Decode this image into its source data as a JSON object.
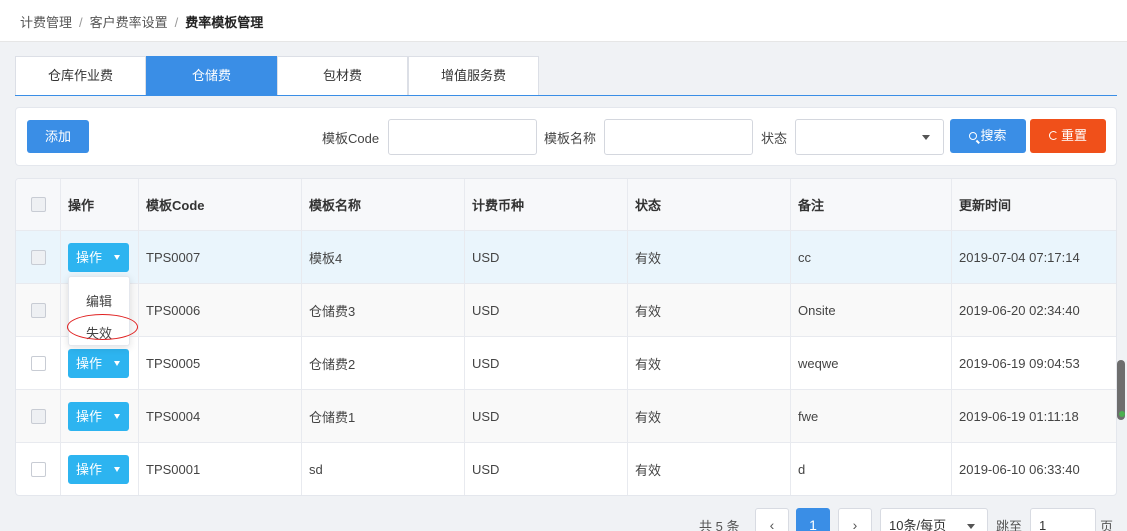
{
  "breadcrumb": {
    "items": [
      "计费管理",
      "客户费率设置",
      "费率模板管理"
    ],
    "separator": "/"
  },
  "tabs": [
    {
      "label": "仓库作业费",
      "active": false
    },
    {
      "label": "仓储费",
      "active": true
    },
    {
      "label": "包材费",
      "active": false
    },
    {
      "label": "增值服务费",
      "active": false
    }
  ],
  "filter": {
    "add_label": "添加",
    "code_label": "模板Code",
    "code_value": "",
    "name_label": "模板名称",
    "name_value": "",
    "status_label": "状态",
    "status_value": "",
    "search_label": "搜索",
    "reset_label": "重置"
  },
  "table": {
    "headers": [
      "操作",
      "模板Code",
      "模板名称",
      "计费币种",
      "状态",
      "备注",
      "更新时间"
    ],
    "op_label": "操作",
    "rows": [
      {
        "code": "TPS0007",
        "name": "模板4",
        "currency": "USD",
        "status": "有效",
        "remark": "cc",
        "updated": "2019-07-04 07:17:14"
      },
      {
        "code": "TPS0006",
        "name": "仓储费3",
        "currency": "USD",
        "status": "有效",
        "remark": "Onsite",
        "updated": "2019-06-20 02:34:40"
      },
      {
        "code": "TPS0005",
        "name": "仓储费2",
        "currency": "USD",
        "status": "有效",
        "remark": "weqwe",
        "updated": "2019-06-19 09:04:53"
      },
      {
        "code": "TPS0004",
        "name": "仓储费1",
        "currency": "USD",
        "status": "有效",
        "remark": "fwe",
        "updated": "2019-06-19 01:11:18"
      },
      {
        "code": "TPS0001",
        "name": "sd",
        "currency": "USD",
        "status": "有效",
        "remark": "d",
        "updated": "2019-06-10 06:33:40"
      }
    ]
  },
  "dropdown": {
    "items": [
      "编辑",
      "失效"
    ]
  },
  "pagination": {
    "total_text": "共 5 条",
    "prev": "‹",
    "current_page": "1",
    "next": "›",
    "page_size": "10条/每页",
    "jump_label": "跳至",
    "jump_value": "1",
    "page_suffix": "页"
  },
  "colors": {
    "primary": "#3a8ee6",
    "op_button": "#2db4f0",
    "reset": "#f0501a",
    "highlight": "#e02020"
  }
}
